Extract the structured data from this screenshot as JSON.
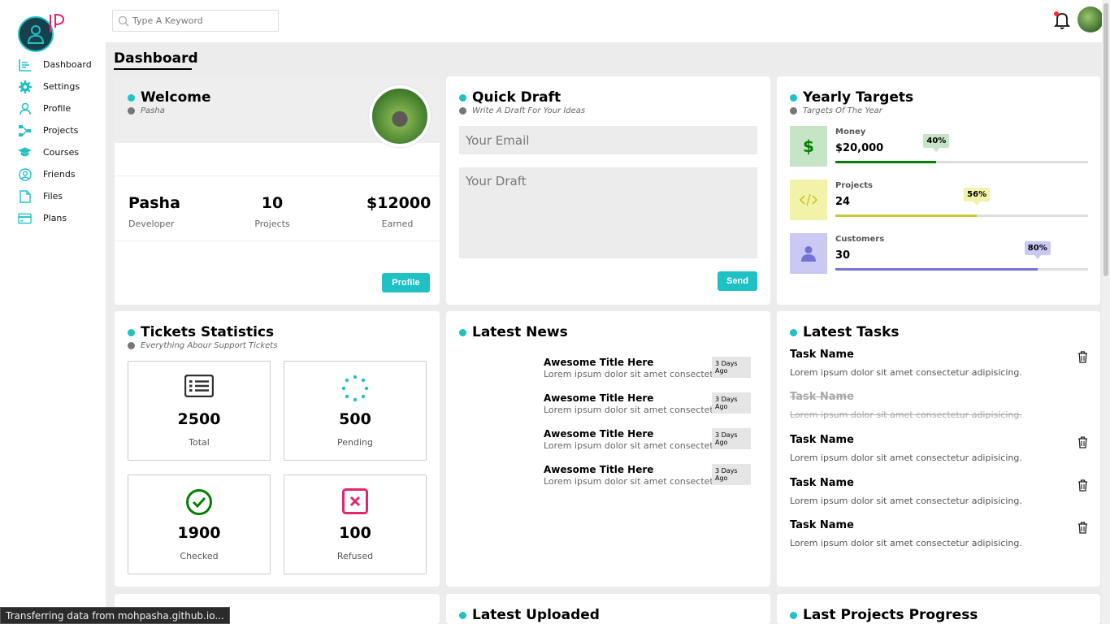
{
  "search": {
    "placeholder": "Type A Keyword"
  },
  "sidebar": {
    "items": [
      {
        "label": "Dashboard"
      },
      {
        "label": "Settings"
      },
      {
        "label": "Profile"
      },
      {
        "label": "Projects"
      },
      {
        "label": "Courses"
      },
      {
        "label": "Friends"
      },
      {
        "label": "Files"
      },
      {
        "label": "Plans"
      }
    ]
  },
  "page": {
    "title": "Dashboard"
  },
  "welcome": {
    "title": "Welcome",
    "subtitle": "Pasha",
    "name": "Pasha",
    "role": "Developer",
    "projects_value": "10",
    "projects_label": "Projects",
    "earned_value": "$12000",
    "earned_label": "Earned",
    "button": "Profile"
  },
  "draft": {
    "title": "Quick Draft",
    "subtitle": "Write A Draft For Your Ideas",
    "email_placeholder": "Your Email",
    "draft_placeholder": "Your Draft",
    "button": "Send"
  },
  "targets": {
    "title": "Yearly Targets",
    "subtitle": "Targets Of The Year",
    "items": [
      {
        "name": "Money",
        "value": "$20,000",
        "percent": 40,
        "percent_label": "40%",
        "color": "#018001",
        "bg": "#c6e4c6",
        "icon": "dollar-icon"
      },
      {
        "name": "Projects",
        "value": "24",
        "percent": 56,
        "percent_label": "56%",
        "color": "#c9c93a",
        "bg": "#f2f2a8",
        "icon": "code-icon"
      },
      {
        "name": "Customers",
        "value": "30",
        "percent": 80,
        "percent_label": "80%",
        "color": "#7373d6",
        "bg": "#c9c9f3",
        "icon": "user-icon"
      }
    ]
  },
  "tickets": {
    "title": "Tickets Statistics",
    "subtitle": "Everything Abour Support Tickets",
    "items": [
      {
        "value": "2500",
        "label": "Total",
        "icon": "list-icon",
        "color": "#333333"
      },
      {
        "value": "500",
        "label": "Pending",
        "icon": "spinner-icon",
        "color": "#1fc1c5"
      },
      {
        "value": "1900",
        "label": "Checked",
        "icon": "check-circle-icon",
        "color": "#018001"
      },
      {
        "value": "100",
        "label": "Refused",
        "icon": "x-box-icon",
        "color": "#e5246f"
      }
    ]
  },
  "news": {
    "title": "Latest News",
    "items": [
      {
        "title": "Awesome Title Here",
        "desc": "Lorem ipsum dolor sit amet consectetur.",
        "date": "3 Days Ago"
      },
      {
        "title": "Awesome Title Here",
        "desc": "Lorem ipsum dolor sit amet consectetur.",
        "date": "3 Days Ago"
      },
      {
        "title": "Awesome Title Here",
        "desc": "Lorem ipsum dolor sit amet consectetur.",
        "date": "3 Days Ago"
      },
      {
        "title": "Awesome Title Here",
        "desc": "Lorem ipsum dolor sit amet consectetur.",
        "date": "3 Days Ago"
      }
    ]
  },
  "tasks": {
    "title": "Latest Tasks",
    "items": [
      {
        "name": "Task Name",
        "desc": "Lorem ipsum dolor sit amet consectetur adipisicing.",
        "done": false
      },
      {
        "name": "Task Name",
        "desc": "Lorem ipsum dolor sit amet consectetur adipisicing.",
        "done": true
      },
      {
        "name": "Task Name",
        "desc": "Lorem ipsum dolor sit amet consectetur adipisicing.",
        "done": false
      },
      {
        "name": "Task Name",
        "desc": "Lorem ipsum dolor sit amet consectetur adipisicing.",
        "done": false
      },
      {
        "name": "Task Name",
        "desc": "Lorem ipsum dolor sit amet consectetur adipisicing.",
        "done": false
      }
    ]
  },
  "uploaded": {
    "title": "Latest Uploaded"
  },
  "projects_progress": {
    "title": "Last Projects Progress"
  },
  "status": {
    "text": "Transferring data from mohpasha.github.io..."
  },
  "colors": {
    "accent": "#1fc1c5",
    "background": "#ececec"
  }
}
